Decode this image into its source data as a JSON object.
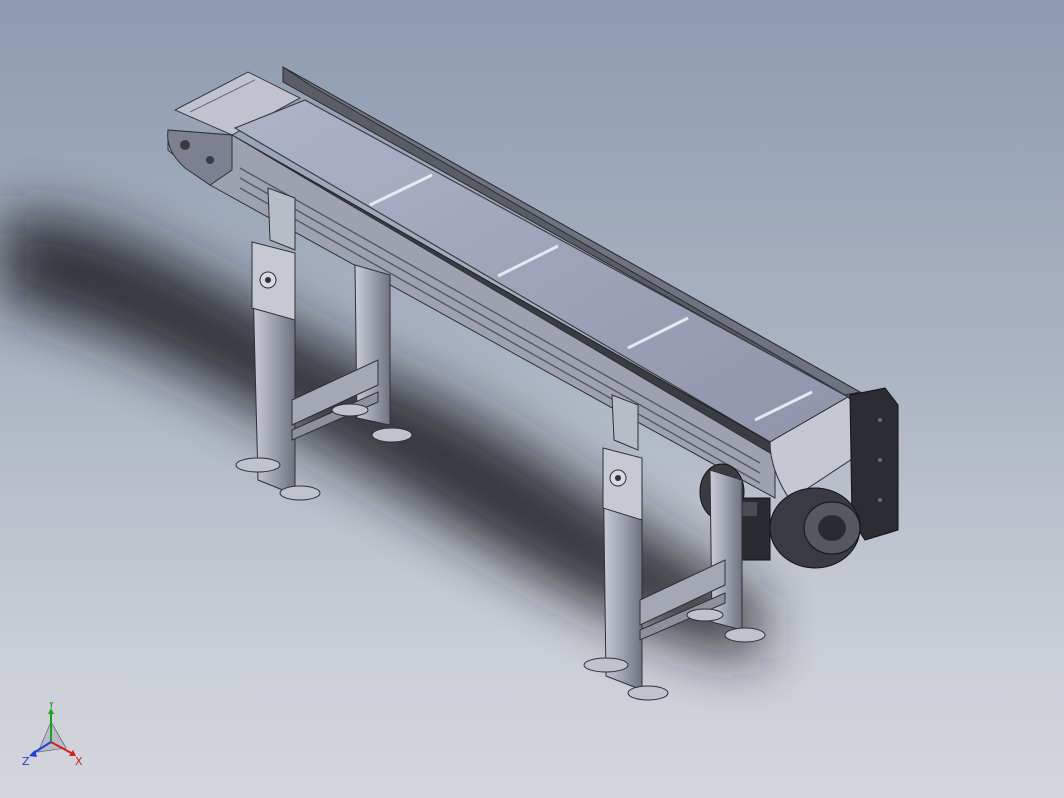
{
  "triad": {
    "x_label": "X",
    "y_label": "Y",
    "z_label": "Z"
  },
  "colors": {
    "background_top": "#8e9bb0",
    "background_bottom": "#d3d6dc",
    "belt": "#9aa0b8",
    "frame_dark": "#4a4d55",
    "frame_light": "#b5b9c6",
    "motor": "#2b2c30",
    "axis_x": "#d02020",
    "axis_y": "#20a020",
    "axis_z": "#2040d0"
  }
}
